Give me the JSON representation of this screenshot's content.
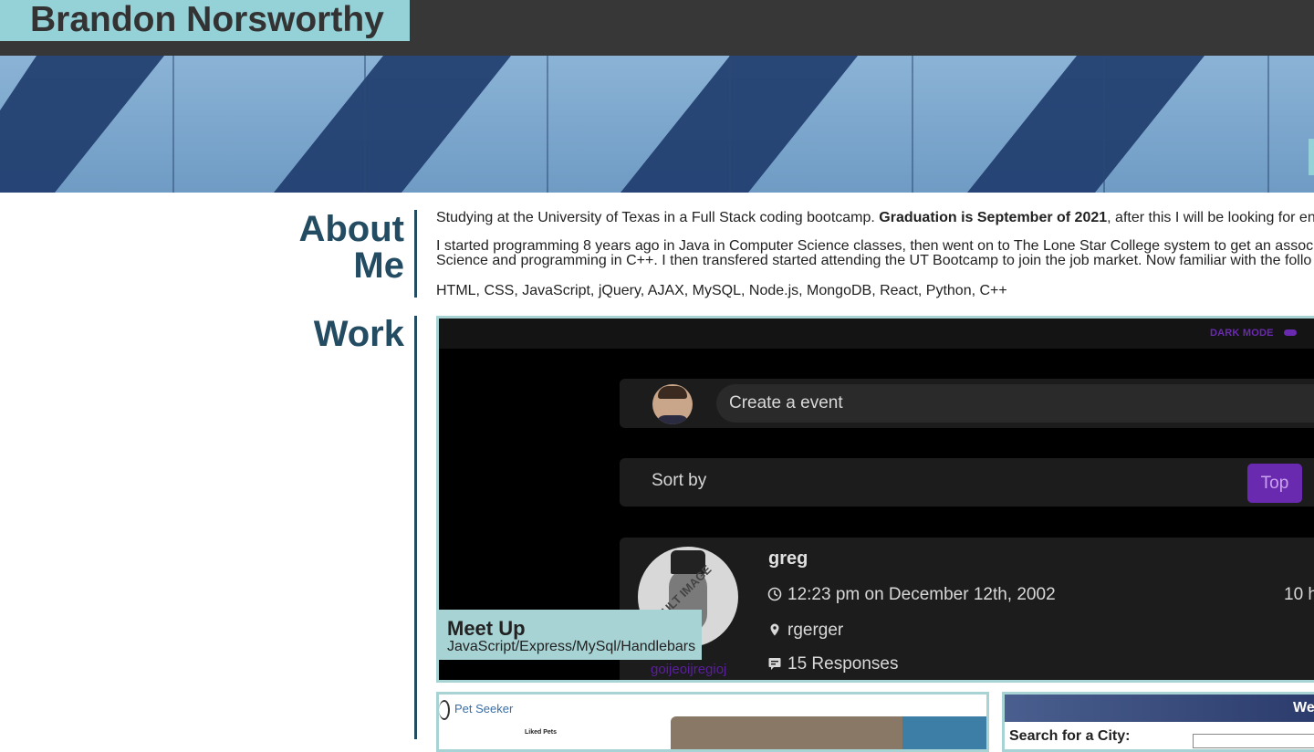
{
  "header": {
    "name": "Brandon Norsworthy"
  },
  "about": {
    "title_line1": "About",
    "title_line2": "Me",
    "p1_start": "Studying at the University of Texas in a Full Stack coding bootcamp. ",
    "p1_bold": "Graduation is September of 2021",
    "p1_end": ", after this I will be looking for en",
    "p2_line1": "I started programming 8 years ago in Java in Computer Science classes, then went on to The Lone Star College system to get an assoc",
    "p2_line2": "Science and programming in C++. I then transfered started attending the UT Bootcamp to join the job market. Now familiar with the follo",
    "skills": "HTML, CSS, JavaScript, jQuery, AJAX, MySQL, Node.js, MongoDB, React, Python, C++"
  },
  "work": {
    "title": "Work",
    "projects": [
      {
        "title": "Meet Up",
        "subtitle": "JavaScript/Express/MySql/Handlebars",
        "screenshot": {
          "dark_mode_label": "DARK MODE",
          "create_placeholder": "Create a event",
          "sort_label": "Sort by",
          "top_button": "Top",
          "default_image_label": "ULT IMAGE",
          "post_user": "greg",
          "post_time": "12:23 pm on December 12th, 2002",
          "post_time_right": "10 h",
          "post_location": "rgerger",
          "post_responses": "15 Responses",
          "event_user": "goijeoijregioj"
        }
      },
      {
        "title": "Pet Seeker",
        "liked_label": "Liked Pets"
      },
      {
        "title": "We",
        "search_label": "Search for a City:"
      }
    ]
  },
  "colors": {
    "accent": "#94d2d8",
    "heading": "#234c63",
    "topbar": "#373737",
    "purple": "#6a2ab0"
  }
}
